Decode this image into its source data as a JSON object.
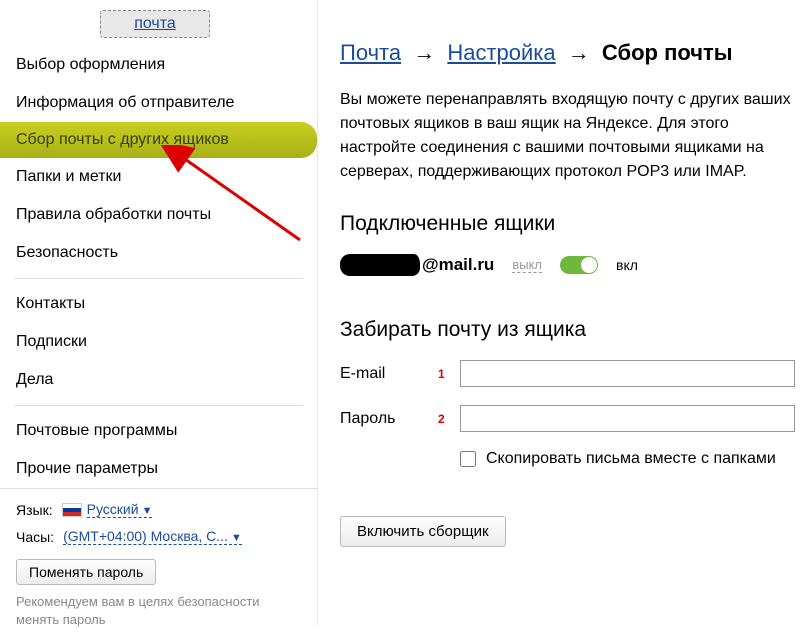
{
  "sidebar": {
    "pochta_tab": "почта",
    "items": [
      {
        "label": "Выбор оформления",
        "active": false
      },
      {
        "label": "Информация об отправителе",
        "active": false
      },
      {
        "label": "Сбор почты с других ящиков",
        "active": true
      },
      {
        "label": "Папки и метки",
        "active": false
      },
      {
        "label": "Правила обработки почты",
        "active": false
      },
      {
        "label": "Безопасность",
        "active": false
      }
    ],
    "items2": [
      {
        "label": "Контакты"
      },
      {
        "label": "Подписки"
      },
      {
        "label": "Дела"
      }
    ],
    "items3": [
      {
        "label": "Почтовые программы"
      },
      {
        "label": "Прочие параметры"
      }
    ],
    "footer": {
      "lang_label": "Язык:",
      "lang_value": "Русский",
      "clock_label": "Часы:",
      "clock_value": "(GMT+04:00) Москва, С...",
      "change_password": "Поменять пароль",
      "recommend": "Рекомендуем вам в целях безопасности менять пароль"
    }
  },
  "main": {
    "breadcrumb": {
      "mail": "Почта",
      "settings": "Настройка",
      "current": "Сбор почты"
    },
    "description": "Вы можете перенаправлять входящую почту с других ваших почтовых ящиков в ваш ящик на Яндексе. Для этого настройте соединения с вашими почтовыми ящиками на серверах, поддерживающих протокол POP3 или IMAP.",
    "connected_title": "Подключенные ящики",
    "mailbox": {
      "domain": "@mail.ru",
      "off": "выкл",
      "on": "вкл"
    },
    "collect_title": "Забирать почту из ящика",
    "form": {
      "email_label": "E-mail",
      "num1": "1",
      "password_label": "Пароль",
      "num2": "2",
      "copy_folders": "Скопировать письма вместе с папками"
    },
    "submit": "Включить сборщик"
  }
}
